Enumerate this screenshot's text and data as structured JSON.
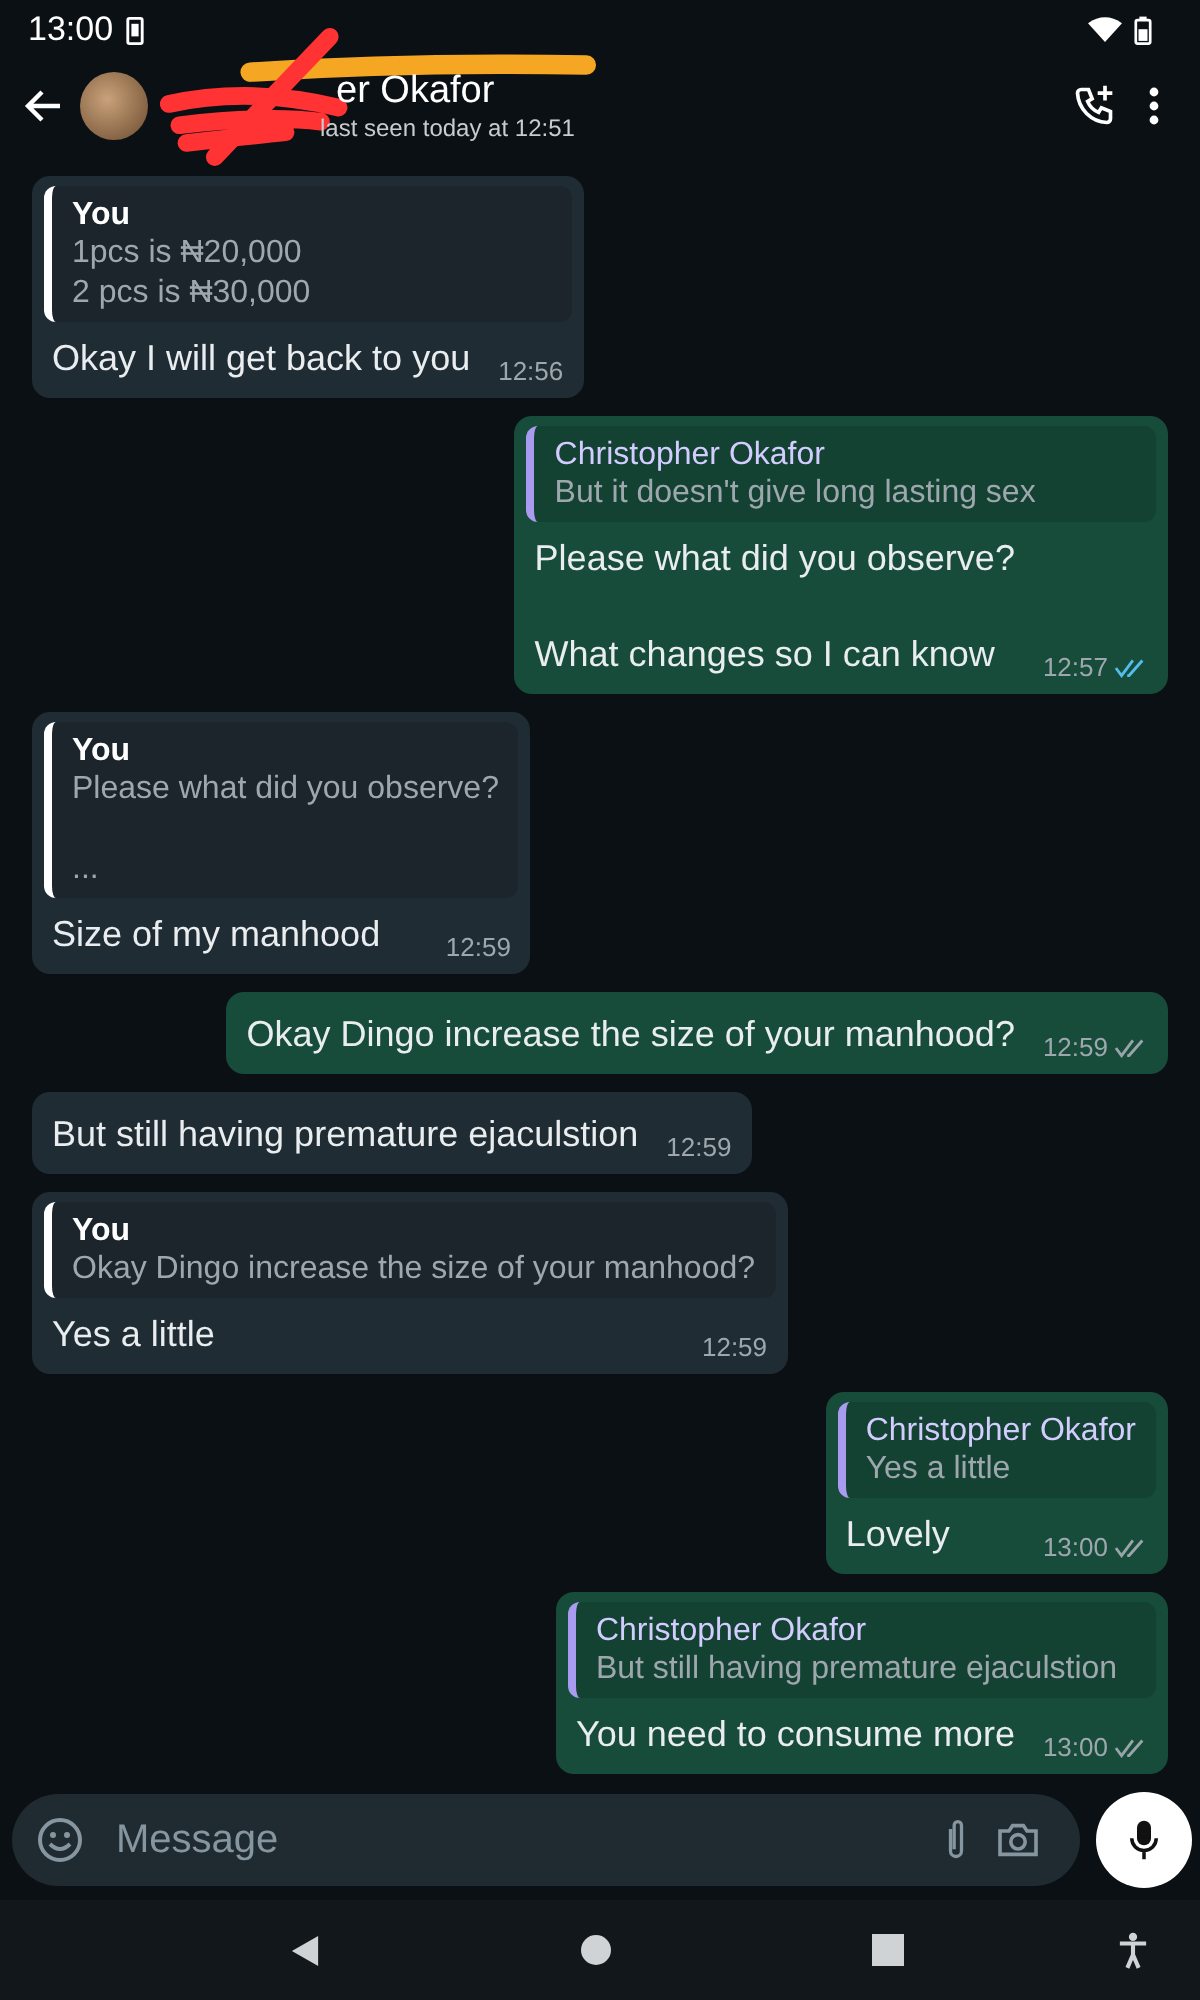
{
  "status_bar": {
    "time": "13:00"
  },
  "header": {
    "contact_name": "er Okafor",
    "last_seen": "last seen today at 12:51"
  },
  "messages": [
    {
      "kind": "in",
      "quote": {
        "author": "You",
        "text": "1pcs is ₦20,000\n2 pcs is ₦30,000"
      },
      "text": "Okay I will get back to you",
      "time": "12:56"
    },
    {
      "kind": "out",
      "quote": {
        "author": "Christopher Okafor",
        "text": "But it doesn't give long lasting sex"
      },
      "text": "Please what did you observe?\n\nWhat changes so I can know",
      "time": "12:57",
      "read": true
    },
    {
      "kind": "in",
      "quote": {
        "author": "You",
        "text": "Please what did you observe?\n\n..."
      },
      "text": "Size of my manhood",
      "time": "12:59"
    },
    {
      "kind": "out",
      "text": "Okay Dingo increase the size of your manhood?",
      "time": "12:59",
      "read": false
    },
    {
      "kind": "in",
      "text": "But still having premature ejaculstion",
      "time": "12:59"
    },
    {
      "kind": "in",
      "quote": {
        "author": "You",
        "text": "Okay Dingo increase the size of your manhood?"
      },
      "text": "Yes a little",
      "time": "12:59"
    },
    {
      "kind": "out",
      "quote": {
        "author": "Christopher Okafor",
        "text": "Yes a little"
      },
      "text": "Lovely",
      "time": "13:00",
      "read": false
    },
    {
      "kind": "out",
      "quote": {
        "author": "Christopher Okafor",
        "text": "But still having premature ejaculstion"
      },
      "text": "You need to consume more",
      "time": "13:00",
      "read": false
    }
  ],
  "composer": {
    "placeholder": "Message"
  }
}
